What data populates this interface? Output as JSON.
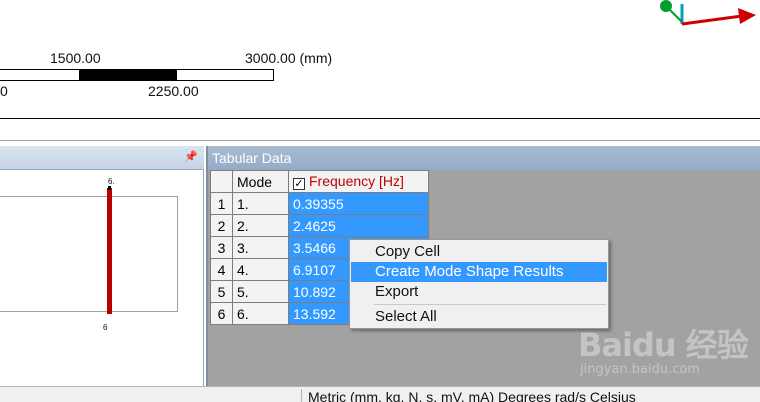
{
  "scale": {
    "label_1500": "1500.00",
    "label_3000": "3000.00 (mm)",
    "label_0": "0",
    "label_2250": "2250.00"
  },
  "left_panel": {
    "top_label": "6.",
    "bottom_label": "6"
  },
  "tabular": {
    "title": "Tabular Data",
    "columns": {
      "mode": "Mode",
      "frequency": "Frequency [Hz]"
    },
    "rows": [
      {
        "index": "1",
        "mode": "1.",
        "frequency": "0.39355"
      },
      {
        "index": "2",
        "mode": "2.",
        "frequency": "2.4625"
      },
      {
        "index": "3",
        "mode": "3.",
        "frequency": "3.5466"
      },
      {
        "index": "4",
        "mode": "4.",
        "frequency": "6.9107"
      },
      {
        "index": "5",
        "mode": "5.",
        "frequency": "10.892"
      },
      {
        "index": "6",
        "mode": "6.",
        "frequency": "13.592"
      }
    ]
  },
  "context_menu": {
    "items": [
      "Copy Cell",
      "Create Mode Shape Results",
      "Export",
      "Select All"
    ],
    "highlighted": "Create Mode Shape Results"
  },
  "bottom_bar": {
    "text": "Metric (mm, kg, N, s, mV, mA)   Degrees   rad/s   Celsius"
  },
  "watermark": {
    "logo": "Baidu 经验",
    "url": "jingyan.baidu.com"
  },
  "colors": {
    "selection": "#3399ff",
    "freq_header": "#c00000",
    "bar": "#b50000",
    "panel_header": "#a9bcd3"
  }
}
